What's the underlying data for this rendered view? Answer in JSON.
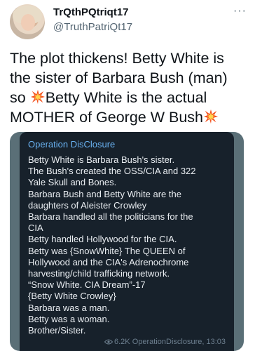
{
  "author": {
    "display_name": "TrQthPQtriqt17",
    "handle": "@TruthPatriQt17",
    "avatar_icon": "profile-avatar"
  },
  "more_icon": "···",
  "tweet": {
    "line1": "The plot thickens! Betty White is",
    "line2": "the sister of Barbara Bush (man)",
    "line3_prefix": "so ",
    "line3_text": "Betty White is the actual",
    "line4_text": "MOTHER of George W Bush",
    "emoji_icon": "collision-icon"
  },
  "embedded_post": {
    "channel": "Operation DisClosure",
    "lines": [
      "Betty White is Barbara Bush's sister.",
      "The Bush's created the OSS/CIA and 322",
      "Yale Skull and Bones.",
      "Barbara Bush and Betty White are the",
      "daughters of Aleister Crowley",
      "Barbara handled all the politicians for the",
      "CIA",
      "Betty handled Hollywood for the CIA.",
      "Betty was {SnowWhite} The QUEEN of",
      "Hollywood and the CIA's Adrenochrome",
      "harvesting/child trafficking network.",
      "“Snow White. CIA Dream”-17",
      "{Betty White Crowley}",
      "Barbara was a man.",
      "Betty was a woman.",
      "Brother/Sister."
    ],
    "views": "6.2K",
    "source": "OperationDisclosure, 13:03"
  },
  "colors": {
    "telegram_bubble": "#17212b",
    "telegram_channel": "#6ab3f3",
    "telegram_bg": "#5a6f77"
  }
}
